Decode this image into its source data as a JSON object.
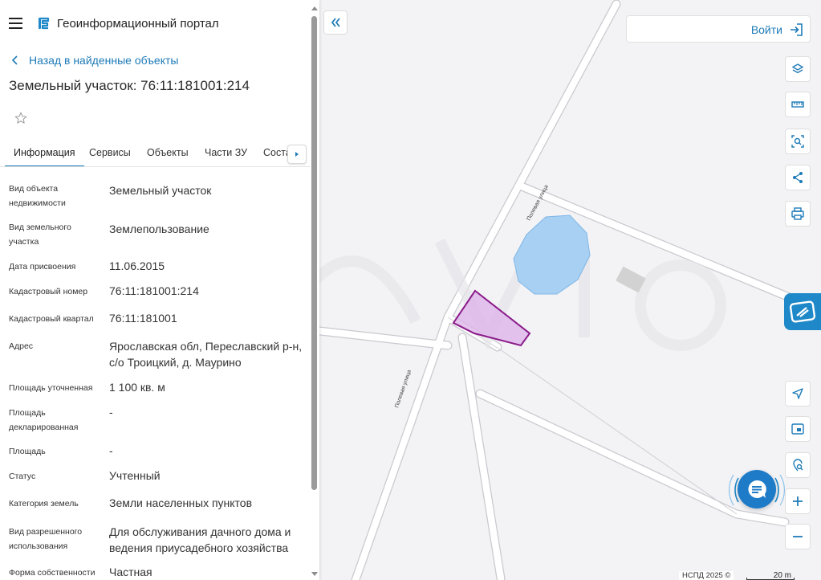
{
  "app": {
    "title": "Геоинформационный портал"
  },
  "nav": {
    "back_label": "Назад в найденные объекты"
  },
  "object": {
    "title": "Земельный участок: 76:11:181001:214"
  },
  "tabs": [
    {
      "label": "Информация",
      "active": true
    },
    {
      "label": "Сервисы",
      "active": false
    },
    {
      "label": "Объекты",
      "active": false
    },
    {
      "label": "Части ЗУ",
      "active": false
    },
    {
      "label": "Состав",
      "active": false
    }
  ],
  "info_rows": [
    {
      "label": "Вид объекта недвижимости",
      "value": "Земельный участок"
    },
    {
      "label": "Вид земельного участка",
      "value": "Землепользование"
    },
    {
      "label": "Дата присвоения",
      "value": "11.06.2015"
    },
    {
      "label": "Кадастровый номер",
      "value": "76:11:181001:214"
    },
    {
      "label": "Кадастровый квартал",
      "value": "76:11:181001"
    },
    {
      "label": "Адрес",
      "value": "Ярославская обл, Переславский р-н, с/о Троицкий, д. Маурино"
    },
    {
      "label": "Площадь уточненная",
      "value": "1 100 кв. м"
    },
    {
      "label": "Площадь декларированная",
      "value": "-"
    },
    {
      "label": "Площадь",
      "value": "-"
    },
    {
      "label": "Статус",
      "value": "Учтенный"
    },
    {
      "label": "Категория земель",
      "value": "Земли населенных пунктов"
    },
    {
      "label": "Вид разрешенного использования",
      "value": "Для обслуживания дачного дома и ведения приусадебного хозяйства"
    },
    {
      "label": "Форма собственности",
      "value": "Частная"
    }
  ],
  "header": {
    "login_label": "Войти"
  },
  "map": {
    "street_labels": [
      "Полевая улица",
      "Полевая улица"
    ],
    "attribution": "НСПД 2025 ©",
    "scale_label": "20 m"
  },
  "icons": {
    "menu": "menu-icon",
    "logo": "portal-logo-icon",
    "back": "chevron-left-icon",
    "favorite": "star-icon",
    "tab_scroll": "caret-right-icon",
    "collapse": "double-chevron-left-icon",
    "login": "login-icon",
    "layers": "layers-icon",
    "ruler": "ruler-icon",
    "select_area": "search-area-icon",
    "share": "share-icon",
    "print": "print-icon",
    "nspd": "nspd-logo-icon",
    "locate": "locate-arrow-icon",
    "minimap": "minimap-icon",
    "geo_search": "geo-search-icon",
    "zoom_in": "plus-icon",
    "zoom_out": "minus-icon",
    "chat": "chat-icon"
  },
  "colors": {
    "accent": "#1e7bb8",
    "parcel_stroke": "#8a1a8a",
    "parcel_fill": "#dcb0e8",
    "water": "#a8d0f2"
  }
}
